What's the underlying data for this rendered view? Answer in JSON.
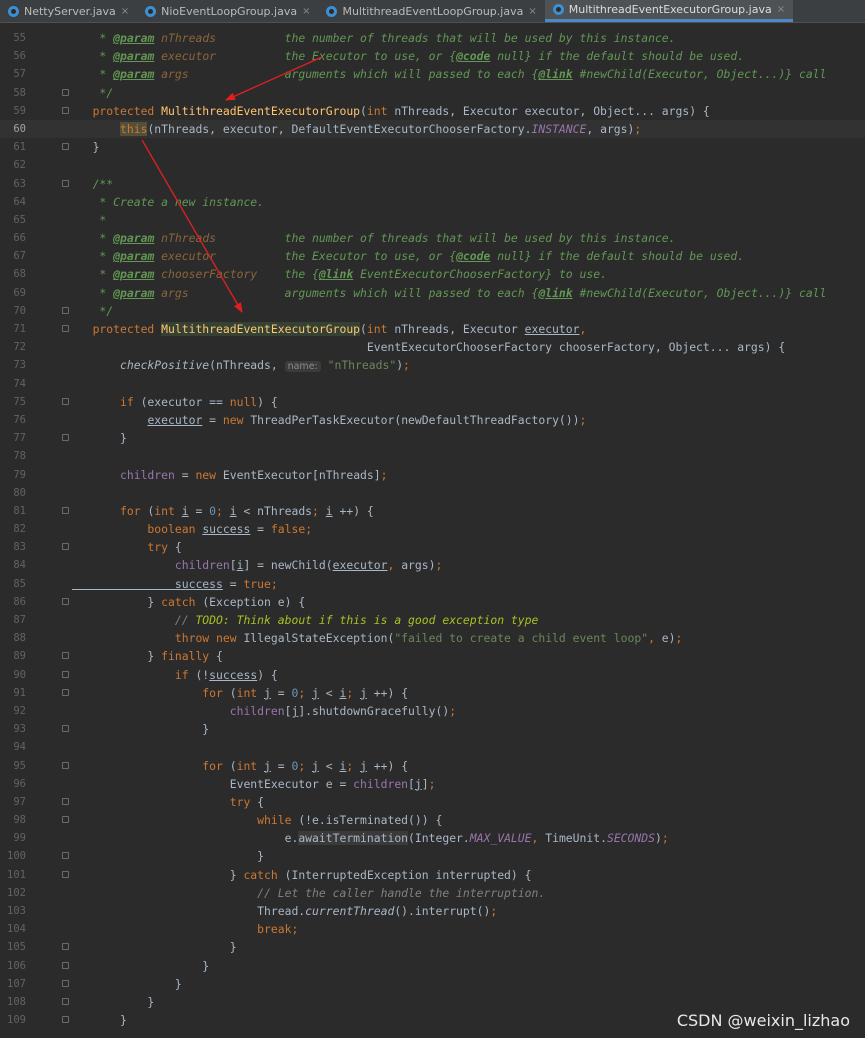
{
  "tabs": [
    {
      "label": "NettyServer.java",
      "active": false
    },
    {
      "label": "NioEventLoopGroup.java",
      "active": false
    },
    {
      "label": "MultithreadEventLoopGroup.java",
      "active": false
    },
    {
      "label": "MultithreadEventExecutorGroup.java",
      "active": true
    }
  ],
  "tab_close_glyph": "×",
  "watermark": "CSDN @weixin_lizhao",
  "colors": {
    "background": "#2b2b2b",
    "keyword": "#cc7832",
    "method": "#ffc66d",
    "comment": "#629755",
    "string": "#6a8759",
    "field": "#9876aa",
    "arrow": "#e02020"
  },
  "editor": {
    "current_line": "60",
    "lines": [
      {
        "n": "55",
        "fold": false,
        "segs": [
          [
            "c",
            "    * "
          ],
          [
            "tag",
            "@param"
          ],
          [
            "c",
            " "
          ],
          [
            "par",
            "nThreads"
          ],
          [
            "c",
            "          the number of threads that will be used by this instance."
          ]
        ]
      },
      {
        "n": "56",
        "fold": false,
        "segs": [
          [
            "c",
            "    * "
          ],
          [
            "tag",
            "@param"
          ],
          [
            "c",
            " "
          ],
          [
            "par",
            "executor"
          ],
          [
            "c",
            "          the Executor to use, or {"
          ],
          [
            "tag",
            "@code"
          ],
          [
            "c",
            " null} if the default should be used."
          ]
        ]
      },
      {
        "n": "57",
        "fold": false,
        "segs": [
          [
            "c",
            "    * "
          ],
          [
            "tag",
            "@param"
          ],
          [
            "c",
            " "
          ],
          [
            "par",
            "args"
          ],
          [
            "c",
            "              arguments which will passed to each {"
          ],
          [
            "tag",
            "@link"
          ],
          [
            "c",
            " #newChild(Executor, Object...)} call"
          ]
        ]
      },
      {
        "n": "58",
        "fold": true,
        "segs": [
          [
            "c",
            "    */"
          ]
        ]
      },
      {
        "n": "59",
        "fold": true,
        "segs": [
          [
            "k",
            "   protected "
          ],
          [
            "m",
            "MultithreadEventExecutorGroup"
          ],
          [
            "p",
            "("
          ],
          [
            "k",
            "int"
          ],
          [
            "p",
            " nThreads, Executor executor, Object... args) {"
          ]
        ]
      },
      {
        "n": "60",
        "fold": false,
        "segs": [
          [
            "p",
            "       "
          ],
          [
            "ksel",
            "this"
          ],
          [
            "p",
            "(nThreads, executor, DefaultEventExecutorChooserFactory."
          ],
          [
            "fi",
            "INSTANCE"
          ],
          [
            "p",
            ", args)"
          ],
          [
            "k",
            ";"
          ]
        ]
      },
      {
        "n": "61",
        "fold": true,
        "segs": [
          [
            "p",
            "   }"
          ]
        ]
      },
      {
        "n": "62",
        "fold": false,
        "segs": []
      },
      {
        "n": "63",
        "fold": true,
        "segs": [
          [
            "c",
            "   /**"
          ]
        ]
      },
      {
        "n": "64",
        "fold": false,
        "segs": [
          [
            "c",
            "    * Create a new instance."
          ]
        ]
      },
      {
        "n": "65",
        "fold": false,
        "segs": [
          [
            "c",
            "    *"
          ]
        ]
      },
      {
        "n": "66",
        "fold": false,
        "segs": [
          [
            "c",
            "    * "
          ],
          [
            "tag",
            "@param"
          ],
          [
            "c",
            " "
          ],
          [
            "par",
            "nThreads"
          ],
          [
            "c",
            "          the number of threads that will be used by this instance."
          ]
        ]
      },
      {
        "n": "67",
        "fold": false,
        "segs": [
          [
            "c",
            "    * "
          ],
          [
            "tag",
            "@param"
          ],
          [
            "c",
            " "
          ],
          [
            "par",
            "executor"
          ],
          [
            "c",
            "          the Executor to use, or {"
          ],
          [
            "tag",
            "@code"
          ],
          [
            "c",
            " null} if the default should be used."
          ]
        ]
      },
      {
        "n": "68",
        "fold": false,
        "segs": [
          [
            "c",
            "    * "
          ],
          [
            "tag",
            "@param"
          ],
          [
            "c",
            " "
          ],
          [
            "par",
            "chooserFactory"
          ],
          [
            "c",
            "    the {"
          ],
          [
            "tag",
            "@link"
          ],
          [
            "c",
            " EventExecutorChooserFactory} to use."
          ]
        ]
      },
      {
        "n": "69",
        "fold": false,
        "segs": [
          [
            "c",
            "    * "
          ],
          [
            "tag",
            "@param"
          ],
          [
            "c",
            " "
          ],
          [
            "par",
            "args"
          ],
          [
            "c",
            "              arguments which will passed to each {"
          ],
          [
            "tag",
            "@link"
          ],
          [
            "c",
            " #newChild(Executor, Object...)} call"
          ]
        ]
      },
      {
        "n": "70",
        "fold": true,
        "segs": [
          [
            "c",
            "    */"
          ]
        ]
      },
      {
        "n": "71",
        "fold": true,
        "segs": [
          [
            "k",
            "   protected "
          ],
          [
            "mh",
            "MultithreadEventExecutorGroup"
          ],
          [
            "p",
            "("
          ],
          [
            "k",
            "int"
          ],
          [
            "p",
            " nThreads, Executor "
          ],
          [
            "u",
            "executor"
          ],
          [
            "k",
            ","
          ]
        ]
      },
      {
        "n": "72",
        "fold": false,
        "segs": [
          [
            "p",
            "                                           EventExecutorChooserFactory chooserFactory, Object... args) {"
          ]
        ]
      },
      {
        "n": "73",
        "fold": false,
        "segs": [
          [
            "it",
            "       checkPositive"
          ],
          [
            "p",
            "(nThreads, "
          ],
          [
            "hint",
            "name:"
          ],
          [
            "s",
            " \"nThreads\""
          ],
          [
            "p",
            ")"
          ],
          [
            "k",
            ";"
          ]
        ]
      },
      {
        "n": "74",
        "fold": false,
        "segs": []
      },
      {
        "n": "75",
        "fold": true,
        "segs": [
          [
            "k",
            "       if "
          ],
          [
            "p",
            "(executor == "
          ],
          [
            "k",
            "null"
          ],
          [
            "p",
            ") {"
          ]
        ]
      },
      {
        "n": "76",
        "fold": false,
        "segs": [
          [
            "p",
            "           "
          ],
          [
            "u",
            "executor"
          ],
          [
            "p",
            " = "
          ],
          [
            "k",
            "new "
          ],
          [
            "p",
            "ThreadPerTaskExecutor(newDefaultThreadFactory())"
          ],
          [
            "k",
            ";"
          ]
        ]
      },
      {
        "n": "77",
        "fold": true,
        "segs": [
          [
            "p",
            "       }"
          ]
        ]
      },
      {
        "n": "78",
        "fold": false,
        "segs": []
      },
      {
        "n": "79",
        "fold": false,
        "segs": [
          [
            "f",
            "       children"
          ],
          [
            "p",
            " = "
          ],
          [
            "k",
            "new "
          ],
          [
            "p",
            "EventExecutor[nThreads]"
          ],
          [
            "k",
            ";"
          ]
        ]
      },
      {
        "n": "80",
        "fold": false,
        "segs": []
      },
      {
        "n": "81",
        "fold": true,
        "segs": [
          [
            "k",
            "       for "
          ],
          [
            "p",
            "("
          ],
          [
            "k",
            "int "
          ],
          [
            "u",
            "i"
          ],
          [
            "p",
            " = "
          ],
          [
            "n",
            "0"
          ],
          [
            "k",
            "; "
          ],
          [
            "u",
            "i"
          ],
          [
            "p",
            " < nThreads"
          ],
          [
            "k",
            "; "
          ],
          [
            "u",
            "i"
          ],
          [
            "p",
            " ++) {"
          ]
        ]
      },
      {
        "n": "82",
        "fold": false,
        "segs": [
          [
            "k",
            "           boolean "
          ],
          [
            "u",
            "success"
          ],
          [
            "p",
            " = "
          ],
          [
            "k",
            "false;"
          ]
        ]
      },
      {
        "n": "83",
        "fold": true,
        "segs": [
          [
            "k",
            "           try "
          ],
          [
            "p",
            "{"
          ]
        ]
      },
      {
        "n": "84",
        "fold": false,
        "segs": [
          [
            "f",
            "               children"
          ],
          [
            "p",
            "["
          ],
          [
            "u",
            "i"
          ],
          [
            "p",
            "] = newChild("
          ],
          [
            "u",
            "executor"
          ],
          [
            "k",
            ", "
          ],
          [
            "p",
            "args)"
          ],
          [
            "k",
            ";"
          ]
        ]
      },
      {
        "n": "85",
        "fold": false,
        "segs": [
          [
            "u",
            "               success"
          ],
          [
            "p",
            " = "
          ],
          [
            "k",
            "true;"
          ]
        ]
      },
      {
        "n": "86",
        "fold": true,
        "segs": [
          [
            "p",
            "           } "
          ],
          [
            "k",
            "catch "
          ],
          [
            "p",
            "(Exception e) {"
          ]
        ]
      },
      {
        "n": "87",
        "fold": false,
        "segs": [
          [
            "lc",
            "               // "
          ],
          [
            "todo",
            "TODO: Think about if this is a good exception type"
          ]
        ]
      },
      {
        "n": "88",
        "fold": false,
        "segs": [
          [
            "k",
            "               throw new "
          ],
          [
            "p",
            "IllegalStateException("
          ],
          [
            "s",
            "\"failed to create a child event loop\""
          ],
          [
            "k",
            ", "
          ],
          [
            "p",
            "e)"
          ],
          [
            "k",
            ";"
          ]
        ]
      },
      {
        "n": "89",
        "fold": true,
        "segs": [
          [
            "p",
            "           } "
          ],
          [
            "k",
            "finally "
          ],
          [
            "p",
            "{"
          ]
        ]
      },
      {
        "n": "90",
        "fold": true,
        "segs": [
          [
            "k",
            "               if "
          ],
          [
            "p",
            "(!"
          ],
          [
            "u",
            "success"
          ],
          [
            "p",
            ") {"
          ]
        ]
      },
      {
        "n": "91",
        "fold": true,
        "segs": [
          [
            "k",
            "                   for "
          ],
          [
            "p",
            "("
          ],
          [
            "k",
            "int "
          ],
          [
            "u",
            "j"
          ],
          [
            "p",
            " = "
          ],
          [
            "n",
            "0"
          ],
          [
            "k",
            "; "
          ],
          [
            "u",
            "j"
          ],
          [
            "p",
            " < "
          ],
          [
            "u",
            "i"
          ],
          [
            "k",
            "; "
          ],
          [
            "u",
            "j"
          ],
          [
            "p",
            " ++) {"
          ]
        ]
      },
      {
        "n": "92",
        "fold": false,
        "segs": [
          [
            "f",
            "                       children"
          ],
          [
            "p",
            "["
          ],
          [
            "u",
            "j"
          ],
          [
            "p",
            "].shutdownGracefully()"
          ],
          [
            "k",
            ";"
          ]
        ]
      },
      {
        "n": "93",
        "fold": true,
        "segs": [
          [
            "p",
            "                   }"
          ]
        ]
      },
      {
        "n": "94",
        "fold": false,
        "segs": []
      },
      {
        "n": "95",
        "fold": true,
        "segs": [
          [
            "k",
            "                   for "
          ],
          [
            "p",
            "("
          ],
          [
            "k",
            "int "
          ],
          [
            "u",
            "j"
          ],
          [
            "p",
            " = "
          ],
          [
            "n",
            "0"
          ],
          [
            "k",
            "; "
          ],
          [
            "u",
            "j"
          ],
          [
            "p",
            " < "
          ],
          [
            "u",
            "i"
          ],
          [
            "k",
            "; "
          ],
          [
            "u",
            "j"
          ],
          [
            "p",
            " ++) {"
          ]
        ]
      },
      {
        "n": "96",
        "fold": false,
        "segs": [
          [
            "p",
            "                       EventExecutor e = "
          ],
          [
            "f",
            "children"
          ],
          [
            "p",
            "["
          ],
          [
            "u",
            "j"
          ],
          [
            "p",
            "]"
          ],
          [
            "k",
            ";"
          ]
        ]
      },
      {
        "n": "97",
        "fold": true,
        "segs": [
          [
            "k",
            "                       try "
          ],
          [
            "p",
            "{"
          ]
        ]
      },
      {
        "n": "98",
        "fold": true,
        "segs": [
          [
            "k",
            "                           while "
          ],
          [
            "p",
            "(!e.isTerminated()) {"
          ]
        ]
      },
      {
        "n": "99",
        "fold": false,
        "segs": [
          [
            "p",
            "                               e."
          ],
          [
            "hl",
            "awaitTermination"
          ],
          [
            "p",
            "(Integer."
          ],
          [
            "fi",
            "MAX_VALUE"
          ],
          [
            "k",
            ", "
          ],
          [
            "p",
            "TimeUnit."
          ],
          [
            "fi",
            "SECONDS"
          ],
          [
            "p",
            ")"
          ],
          [
            "k",
            ";"
          ]
        ]
      },
      {
        "n": "100",
        "fold": true,
        "segs": [
          [
            "p",
            "                           }"
          ]
        ]
      },
      {
        "n": "101",
        "fold": true,
        "segs": [
          [
            "p",
            "                       } "
          ],
          [
            "k",
            "catch "
          ],
          [
            "p",
            "(InterruptedException interrupted) {"
          ]
        ]
      },
      {
        "n": "102",
        "fold": false,
        "segs": [
          [
            "lc",
            "                           // Let the caller handle the interruption."
          ]
        ]
      },
      {
        "n": "103",
        "fold": false,
        "segs": [
          [
            "p",
            "                           Thread."
          ],
          [
            "it",
            "currentThread"
          ],
          [
            "p",
            "().interrupt()"
          ],
          [
            "k",
            ";"
          ]
        ]
      },
      {
        "n": "104",
        "fold": false,
        "segs": [
          [
            "k",
            "                           break;"
          ]
        ]
      },
      {
        "n": "105",
        "fold": true,
        "segs": [
          [
            "p",
            "                       }"
          ]
        ]
      },
      {
        "n": "106",
        "fold": true,
        "segs": [
          [
            "p",
            "                   }"
          ]
        ]
      },
      {
        "n": "107",
        "fold": true,
        "segs": [
          [
            "p",
            "               }"
          ]
        ]
      },
      {
        "n": "108",
        "fold": true,
        "segs": [
          [
            "p",
            "           }"
          ]
        ]
      },
      {
        "n": "109",
        "fold": true,
        "segs": [
          [
            "p",
            "       }"
          ]
        ]
      }
    ]
  }
}
